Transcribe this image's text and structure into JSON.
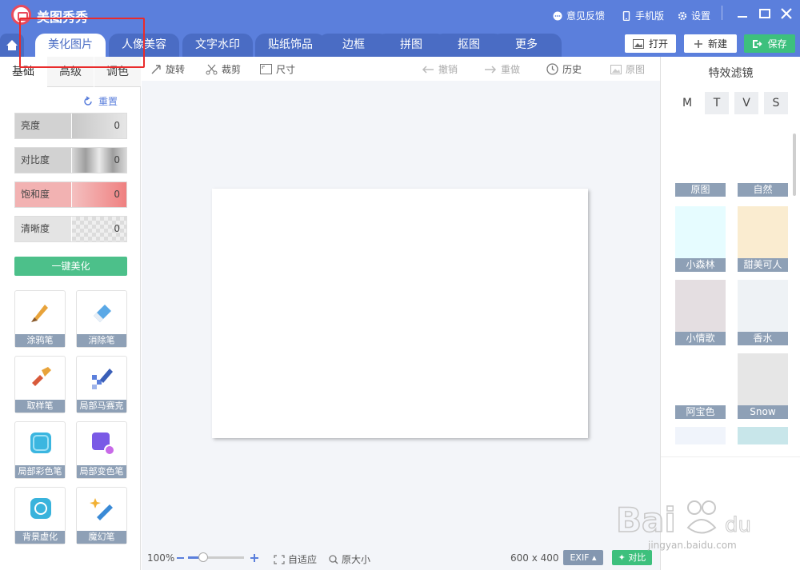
{
  "app": {
    "title": "美图秀秀"
  },
  "titlebar": {
    "feedback": "意见反馈",
    "mobile": "手机版",
    "settings": "设置"
  },
  "tabs": [
    "美化图片",
    "人像美容",
    "文字水印",
    "贴纸饰品",
    "边框",
    "拼图",
    "抠图",
    "更多"
  ],
  "header_buttons": {
    "open": "打开",
    "new": "新建",
    "save": "保存"
  },
  "left_panel": {
    "subtabs": [
      "基础",
      "高级",
      "调色"
    ],
    "reset": "重置",
    "sliders": [
      {
        "label": "亮度",
        "value": "0"
      },
      {
        "label": "对比度",
        "value": "0"
      },
      {
        "label": "饱和度",
        "value": "0"
      },
      {
        "label": "清晰度",
        "value": "0"
      }
    ],
    "one_key": "一键美化",
    "tools": [
      "涂鸦笔",
      "消除笔",
      "取样笔",
      "局部马赛克",
      "局部彩色笔",
      "局部变色笔",
      "背景虚化",
      "魔幻笔"
    ]
  },
  "toolbar": {
    "rotate": "旋转",
    "crop": "裁剪",
    "size": "尺寸",
    "undo": "撤销",
    "redo": "重做",
    "history": "历史",
    "original": "原图"
  },
  "bottom_bar": {
    "zoom": "100%",
    "zoom_level": 0.27,
    "fit": "自适应",
    "actual": "原大小",
    "dimensions": "600 x 400",
    "exif": "EXIF",
    "compare": "对比"
  },
  "right_panel": {
    "title": "特效滤镜",
    "letters": [
      "M",
      "T",
      "V",
      "S"
    ],
    "filters": [
      "原图",
      "自然",
      "小森林",
      "甜美可人",
      "小情歌",
      "香水",
      "阿宝色",
      "Snow"
    ]
  },
  "watermark": {
    "text": "jingyan.baidu.com"
  },
  "colors": {
    "accent": "#5b7fdc",
    "green": "#3dc07d",
    "highlight": "#e92b2b"
  }
}
